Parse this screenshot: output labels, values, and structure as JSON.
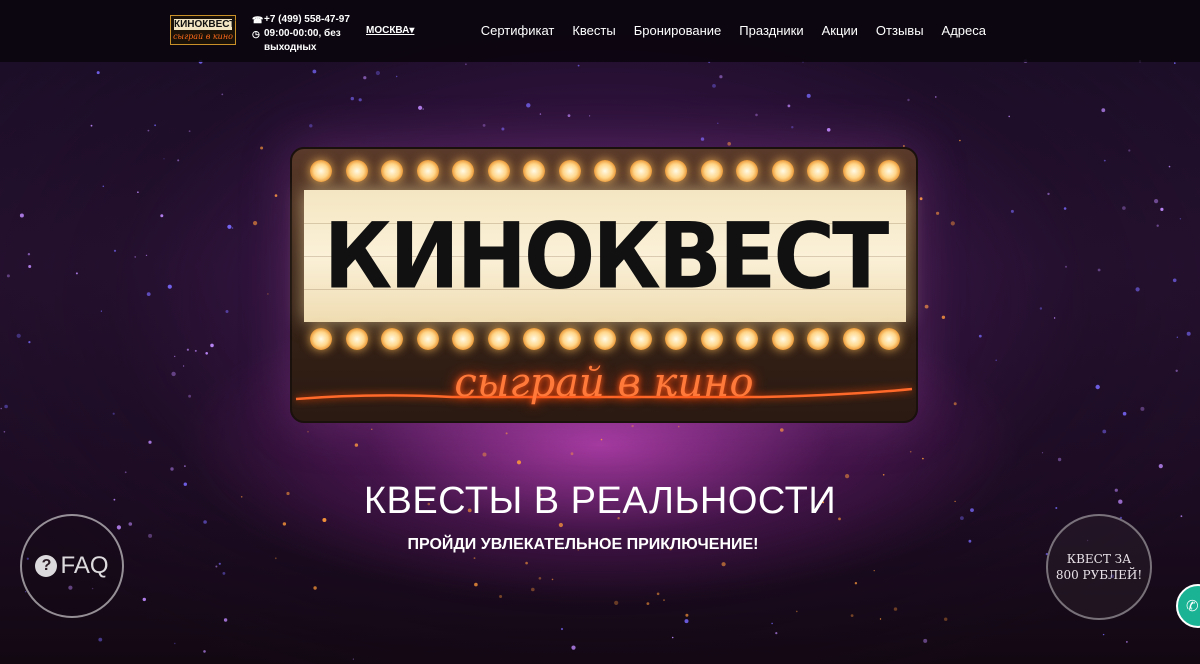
{
  "header": {
    "logo": {
      "title": "КИНОКВЕСТ",
      "tagline": "сыграй в кино"
    },
    "phone": "+7 (499) 558-47-97",
    "hours": "09:00-00:00, без выходных",
    "city": "МОСКВА▾",
    "nav": [
      "Сертификат",
      "Квесты",
      "Бронирование",
      "Праздники",
      "Акции",
      "Отзывы",
      "Адреса"
    ]
  },
  "hero": {
    "sign_title": "КИНОКВЕСТ",
    "sign_tagline": "сыграй в кино",
    "headline": "КВЕСТЫ В РЕАЛЬНОСТИ",
    "subheadline": "ПРОЙДИ УВЛЕКАТЕЛЬНОЕ ПРИКЛЮЧЕНИЕ!"
  },
  "faq": {
    "icon": "question-circle-icon",
    "label": "FAQ"
  },
  "promo": {
    "line1": "КВЕСТ ЗА",
    "line2": "800 РУБЛЕЙ!"
  },
  "call": {
    "icon": "phone-icon"
  },
  "colors": {
    "header_bg": "#0a060e",
    "neon": "#ff7a3a",
    "call_button": "#1ab495",
    "bulb": "#ffd68a"
  }
}
